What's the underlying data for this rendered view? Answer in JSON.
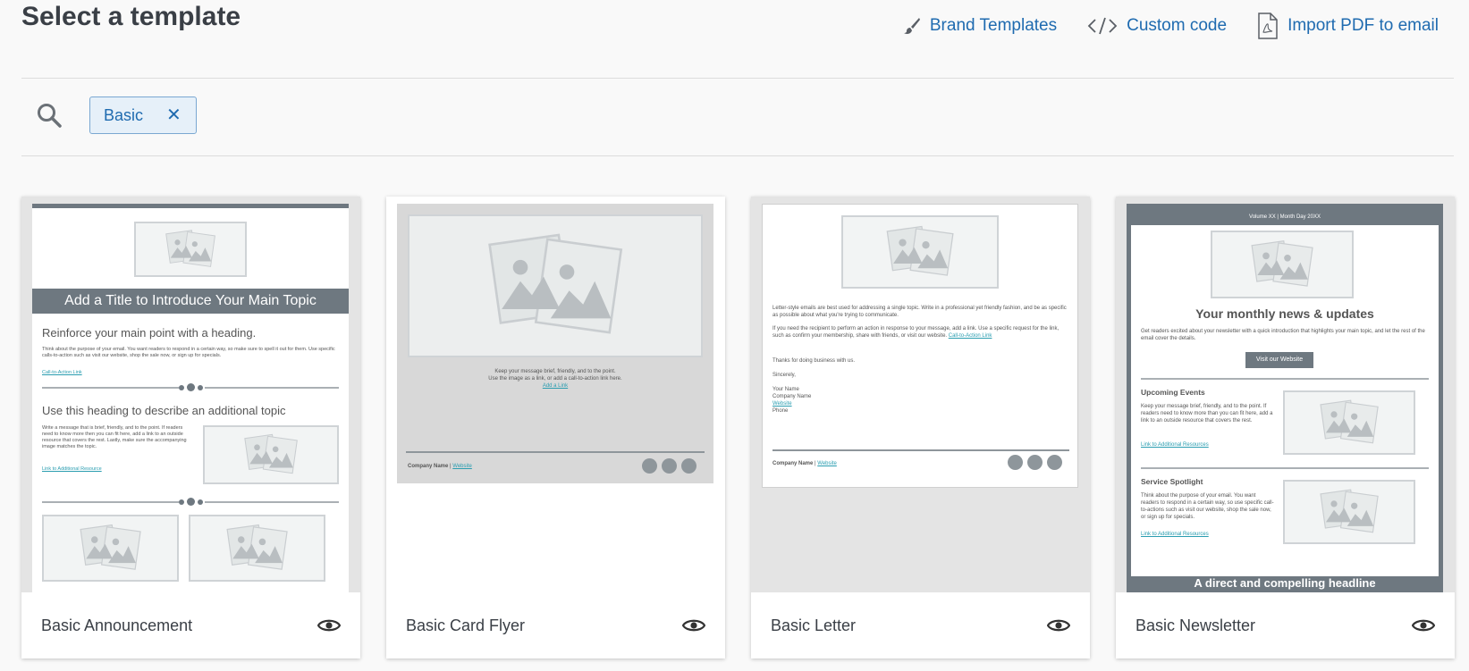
{
  "page": {
    "title": "Select a template"
  },
  "actions": [
    {
      "label": "Brand Templates",
      "icon": "paintbrush-icon"
    },
    {
      "label": "Custom code",
      "icon": "code-icon"
    },
    {
      "label": "Import PDF to email",
      "icon": "pdf-file-icon"
    }
  ],
  "search": {
    "icon": "search-icon",
    "filter_chip": "Basic",
    "remove_icon": "close-icon"
  },
  "colors": {
    "accent": "#1f6bb0",
    "chip_bg": "#e6f0f9",
    "template_dark": "#6e7880"
  },
  "templates": [
    {
      "name": "Basic Announcement",
      "preview": {
        "banner": "Add a Title to Introduce Your Main Topic",
        "heading1": "Reinforce your main point with a heading.",
        "body1": "Think about the purpose of your email. You want readers to respond in a certain way, so make sure to spell it out for them. Use specific calls-to-action such as visit our website, shop the sale now, or sign up for specials.",
        "link1": "Call-to-Action Link",
        "heading2": "Use this heading to describe an additional topic",
        "body2": "Write a message that is brief, friendly, and to the point. If readers need to know more then you can fit here, add a link to an outside resource that covers the rest. Lastly, make sure the accompanying image matches the topic.",
        "link2": "Link to Additional Resource"
      }
    },
    {
      "name": "Basic Card Flyer",
      "preview": {
        "line1": "Keep your message brief, friendly, and to the point.",
        "line2": "Use the image as a link, or add a call-to-action link here.",
        "link": "Add a Link",
        "company": "Company Name",
        "separator": " | ",
        "website": "Website"
      }
    },
    {
      "name": "Basic Letter",
      "preview": {
        "p1": "Letter-style emails are best used for addressing a single topic. Write in a professional yet friendly fashion, and be as specific as possible about what you're trying to communicate.",
        "p2": "If you need the recipient to perform an action in response to your message, add a link. Use a specific request for the link, such as confirm your membership, share with friends, or visit our website.",
        "p2_link": "Call-to-Action Link",
        "p3": "Thanks for doing business with us.",
        "closing": "Sincerely,",
        "sig_name": "Your Name",
        "sig_company": "Company Name",
        "sig_website": "Website",
        "sig_phone": "Phone",
        "company": "Company Name",
        "separator": " | ",
        "website": "Website"
      }
    },
    {
      "name": "Basic Newsletter",
      "preview": {
        "volume": "Volume XX | Month Day 20XX",
        "headline": "Your monthly news & updates",
        "intro": "Get readers excited about your newsletter with a quick introduction that highlights your main topic, and let the rest of the email cover the details.",
        "button": "Visit our Website",
        "section1_title": "Upcoming Events",
        "section1_body": "Keep your message brief, friendly, and to the point. If readers need to know more than you can fit here, add a link to an outside resource that covers the rest.",
        "section1_link": "Link to Additional Resources",
        "section2_title": "Service Spotlight",
        "section2_body": "Think about the purpose of your email. You want readers to respond in a certain way, so use specific call-to-actions such as visit our website, shop the sale now, or sign up for specials.",
        "section2_link": "Link to Additional Resources",
        "footer_banner": "A direct and compelling headline"
      }
    }
  ]
}
